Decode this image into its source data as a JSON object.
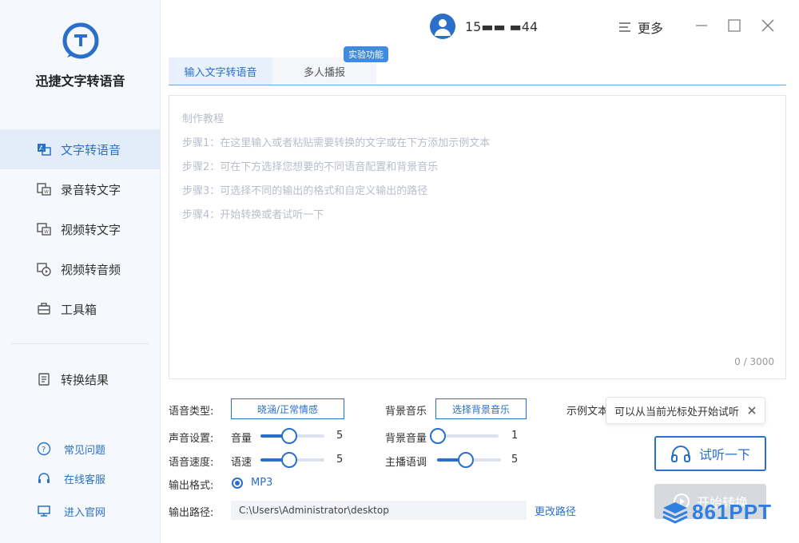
{
  "app": {
    "title": "迅捷文字转语音"
  },
  "sidebar": {
    "items": [
      {
        "label": "文字转语音",
        "icon": "text-to-speech-icon",
        "active": true
      },
      {
        "label": "录音转文字",
        "icon": "recording-to-text-icon"
      },
      {
        "label": "视频转文字",
        "icon": "video-to-text-icon"
      },
      {
        "label": "视频转音频",
        "icon": "video-to-audio-icon"
      },
      {
        "label": "工具箱",
        "icon": "toolbox-icon"
      }
    ],
    "results": {
      "label": "转换结果",
      "icon": "results-icon"
    },
    "footer": [
      {
        "label": "常见问题",
        "icon": "question-icon"
      },
      {
        "label": "在线客服",
        "icon": "headset-icon"
      },
      {
        "label": "进入官网",
        "icon": "monitor-icon"
      }
    ]
  },
  "header": {
    "user": "15▬▬ ▬44",
    "more": "更多"
  },
  "tabs": [
    {
      "label": "输入文字转语音",
      "active": true
    },
    {
      "label": "多人播报"
    }
  ],
  "badge": "实验功能",
  "editor": {
    "hints": [
      "制作教程",
      "步骤1：在这里输入或者粘贴需要转换的文字或在下方添加示例文本",
      "步骤2：可在下方选择您想要的不同语音配置和背景音乐",
      "步骤3：可选择不同的输出的格式和自定义输出的路径",
      "步骤4：开始转换或者试听一下"
    ],
    "count": "0 / 3000"
  },
  "settings": {
    "voice_type_label": "语音类型:",
    "voice_type_value": "晓涵/正常情感",
    "bg_music_label": "背景音乐",
    "bg_music_value": "选择背景音乐",
    "example_label": "示例文本",
    "sound_label": "声音设置:",
    "volume_label": "音量",
    "volume_value": "5",
    "bg_volume_label": "背景音量",
    "bg_volume_value": "1",
    "speed_label": "语音速度:",
    "speed_sub": "语速",
    "speed_value": "5",
    "pitch_label": "主播语调",
    "pitch_value": "5",
    "format_label": "输出格式:",
    "format_value": "MP3",
    "path_label": "输出路径:",
    "path_value": "C:\\Users\\Administrator\\desktop",
    "change_path": "更改路径"
  },
  "slider_levels": {
    "volume": 0.45,
    "bg_volume": 0.05,
    "speed": 0.45,
    "pitch": 0.45
  },
  "tooltip": "可以从当前光标处开始试听",
  "buttons": {
    "listen": "试听一下",
    "start": "开始转换"
  },
  "watermark": "861PPT",
  "colors": {
    "accent": "#2a6fc9",
    "sidebar_bg": "#f5f8fc",
    "active_bg": "#e3edf9"
  }
}
